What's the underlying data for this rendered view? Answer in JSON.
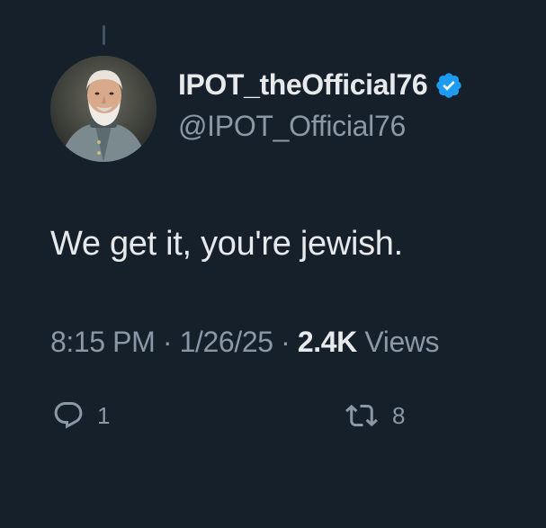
{
  "tweet": {
    "display_name": "IPOT_theOfficial76",
    "handle": "@IPOT_Official76",
    "text": "We get it, you're jewish.",
    "time": "8:15 PM",
    "separator": "·",
    "date": "1/26/25",
    "views_count": "2.4K",
    "views_label": "Views"
  },
  "actions": {
    "reply_count": "1",
    "repost_count": "8"
  },
  "icons": {
    "verified": "verified-badge-icon",
    "reply": "reply-bubble-icon",
    "repost": "repost-arrows-icon"
  },
  "colors": {
    "background": "#15202b",
    "verified": "#1d9bf0",
    "secondary_text": "#8b98a5",
    "primary_text": "#e7e9ea"
  }
}
